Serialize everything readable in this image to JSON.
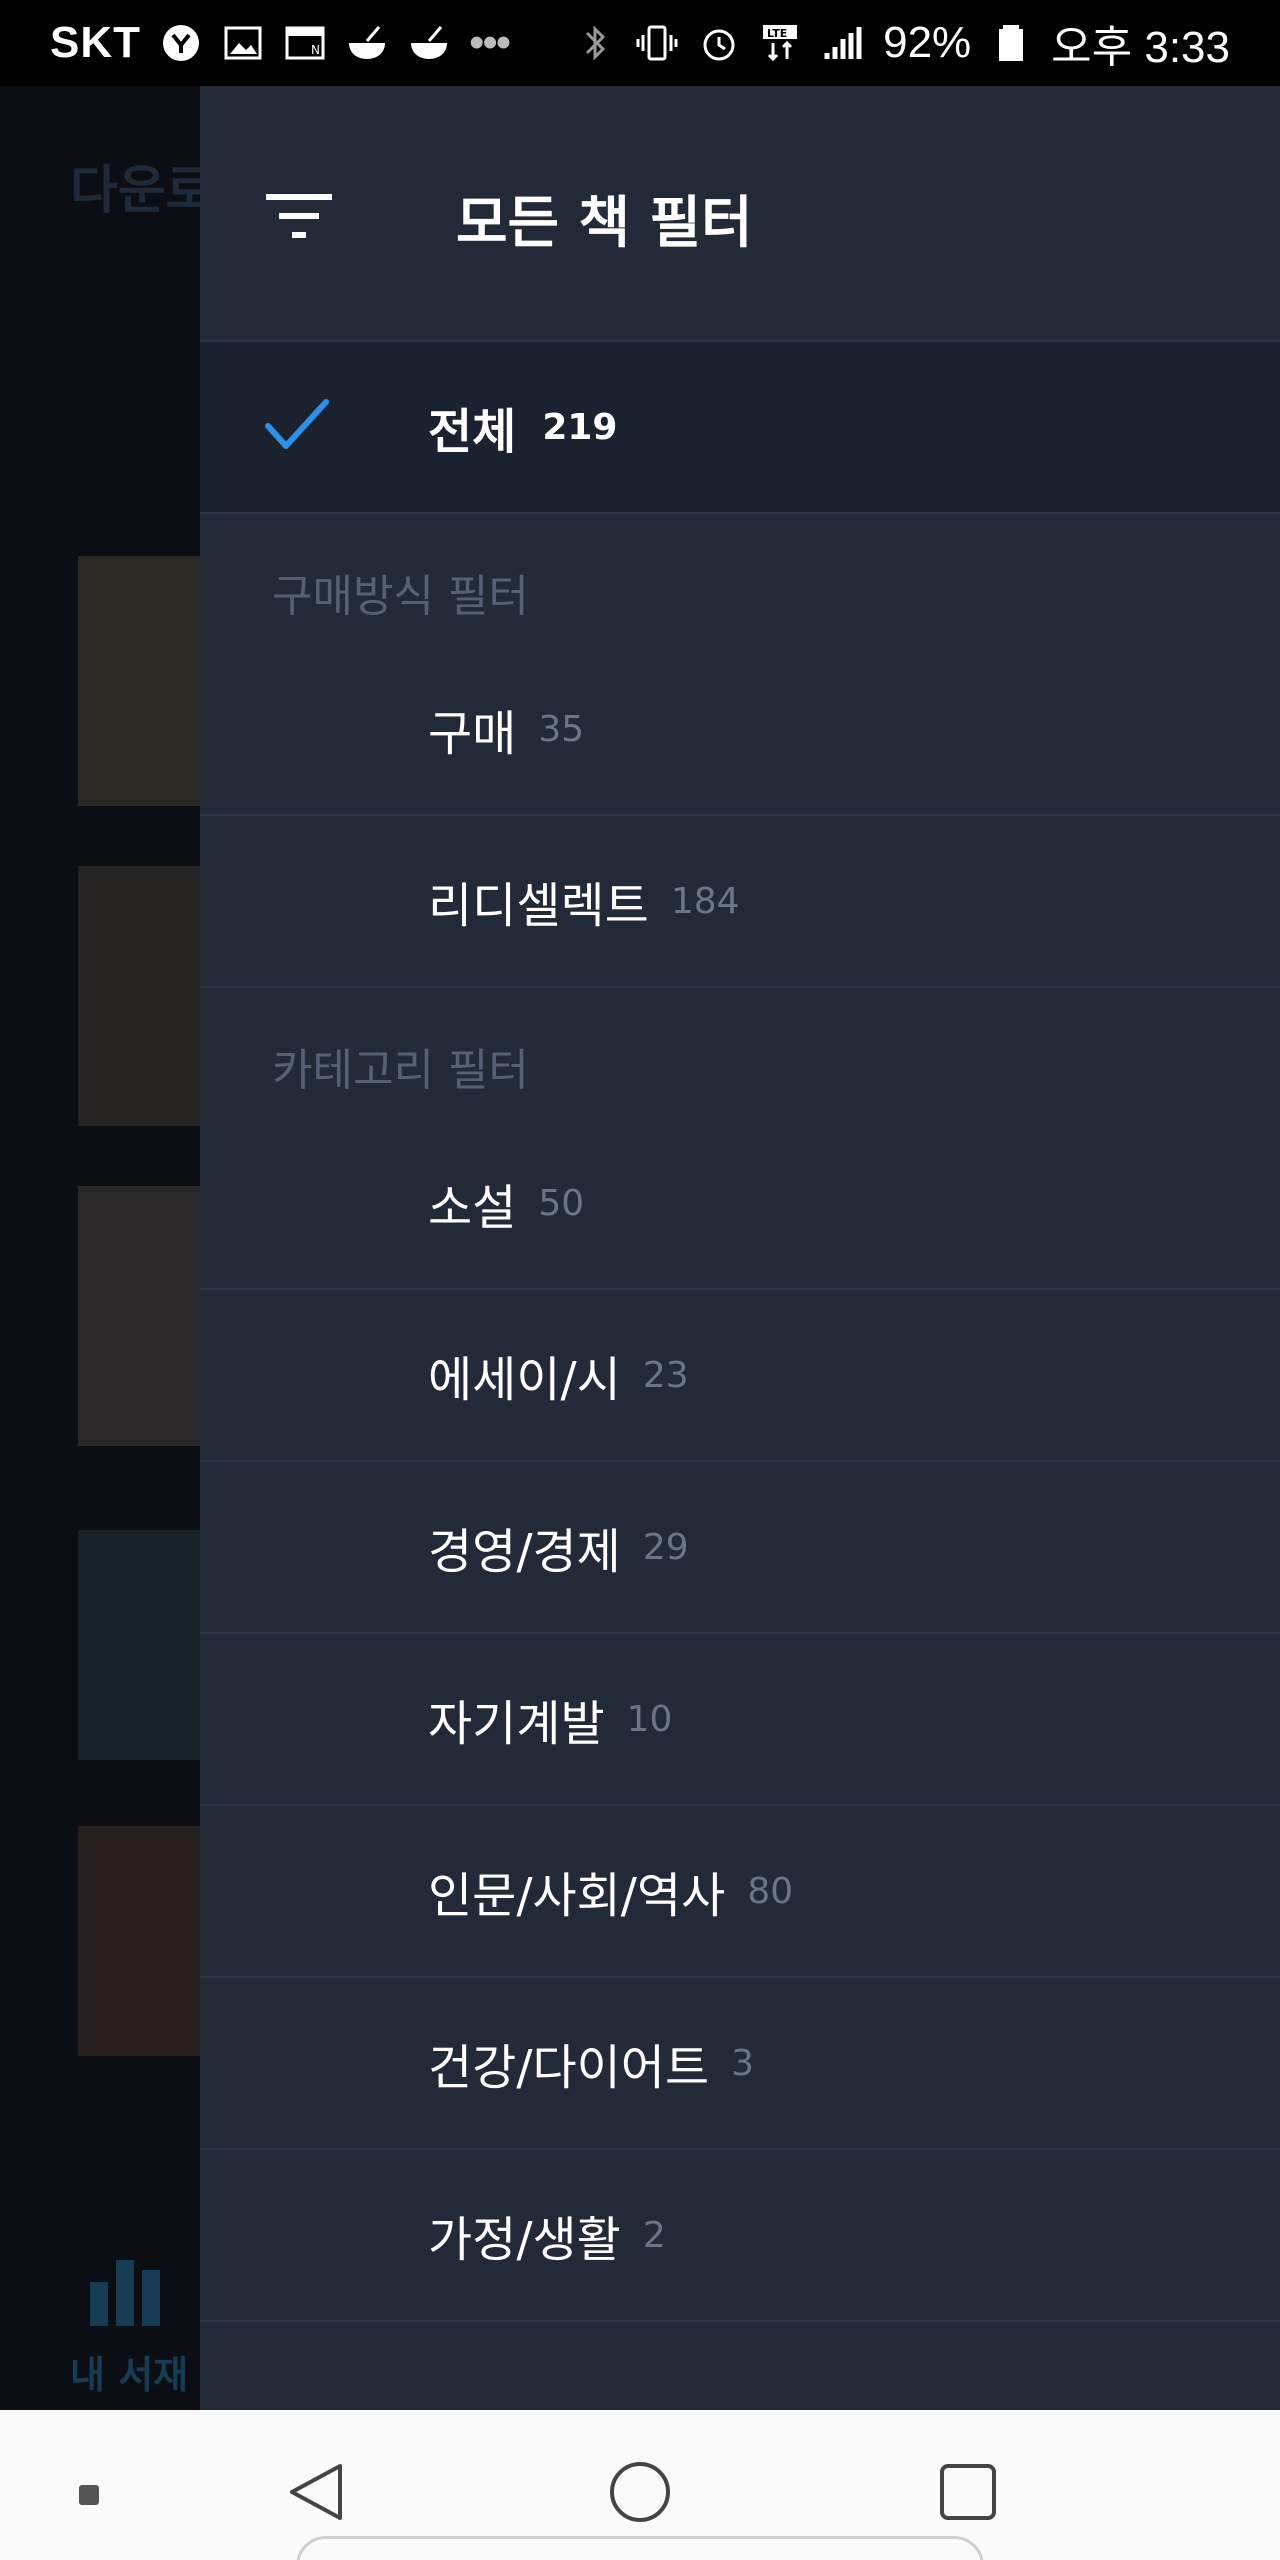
{
  "status_bar": {
    "carrier": "SKT",
    "battery": "92%",
    "time": "오후 3:33",
    "more": "•••"
  },
  "background": {
    "title": "다운로",
    "tab_label": "내 서재"
  },
  "drawer": {
    "title": "모든 책 필터",
    "all": {
      "label": "전체",
      "count": "219",
      "selected": true
    },
    "sections": [
      {
        "header": "구매방식 필터",
        "items": [
          {
            "label": "구매",
            "count": "35"
          },
          {
            "label": "리디셀렉트",
            "count": "184"
          }
        ]
      },
      {
        "header": "카테고리 필터",
        "items": [
          {
            "label": "소설",
            "count": "50"
          },
          {
            "label": "에세이/시",
            "count": "23"
          },
          {
            "label": "경영/경제",
            "count": "29"
          },
          {
            "label": "자기계발",
            "count": "10"
          },
          {
            "label": "인문/사회/역사",
            "count": "80"
          },
          {
            "label": "건강/다이어트",
            "count": "3"
          },
          {
            "label": "가정/생활",
            "count": "2"
          }
        ]
      }
    ]
  },
  "colors": {
    "drawer_bg": "#222a38",
    "selected_bg": "#1a2230",
    "accent_check": "#2f8fe6",
    "muted_text": "#566072",
    "count_text": "#6b7585"
  }
}
